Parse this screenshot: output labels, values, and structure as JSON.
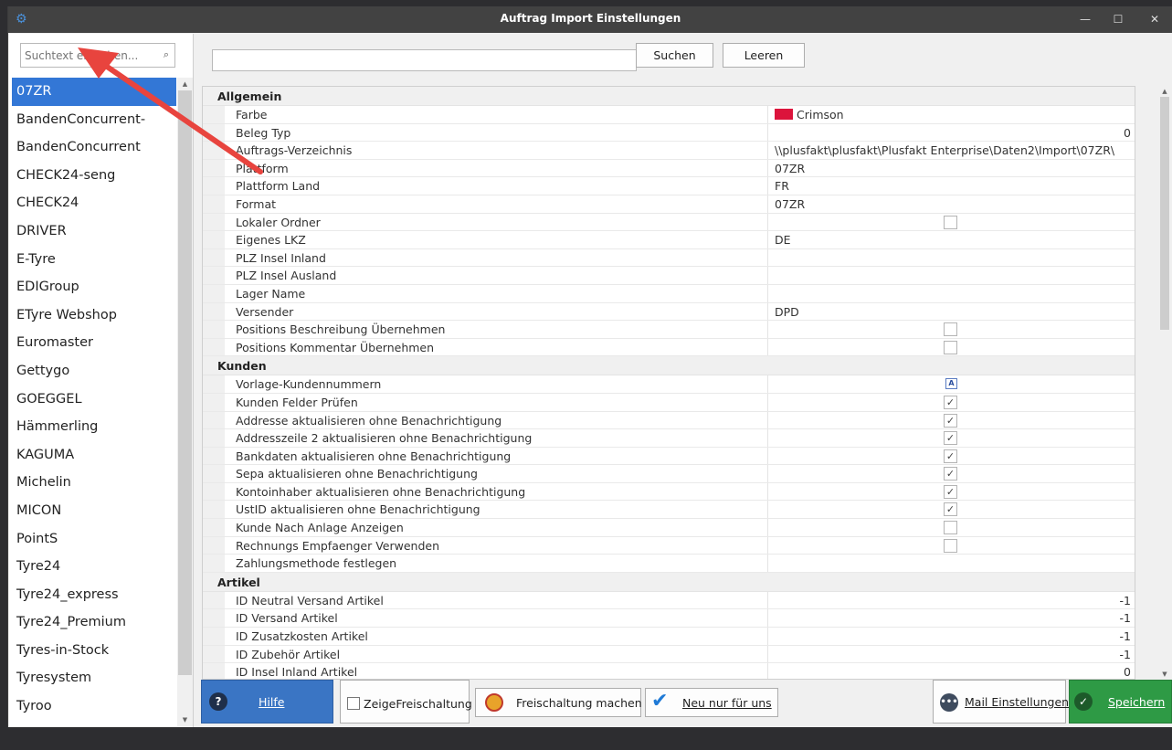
{
  "window": {
    "title": "Auftrag Import Einstellungen"
  },
  "sidebar": {
    "search_placeholder": "Suchtext eingeben...",
    "items": [
      "07ZR",
      "BandenConcurrent-",
      "BandenConcurrent",
      "CHECK24-seng",
      "CHECK24",
      "DRIVER",
      "E-Tyre",
      "EDIGroup",
      "ETyre Webshop",
      "Euromaster",
      "Gettygo",
      "GOEGGEL",
      "Hämmerling",
      "KAGUMA",
      "Michelin",
      "MICON",
      "PointS",
      "Tyre24",
      "Tyre24_express",
      "Tyre24_Premium",
      "Tyres-in-Stock",
      "Tyresystem",
      "Tyroo"
    ],
    "selected": "07ZR"
  },
  "toolbar": {
    "search_label": "Suchen",
    "clear_label": "Leeren"
  },
  "properties": {
    "allgemein": {
      "title": "Allgemein",
      "rows": {
        "farbe": {
          "label": "Farbe",
          "value": "Crimson",
          "color": "#dc143c"
        },
        "beleg_typ": {
          "label": "Beleg Typ",
          "value": "0"
        },
        "auftrags_verzeichnis": {
          "label": "Auftrags-Verzeichnis",
          "value": "\\\\plusfakt\\plusfakt\\Plusfakt Enterprise\\Daten2\\Import\\07ZR\\"
        },
        "plattform": {
          "label": "Plattform",
          "value": "07ZR"
        },
        "plattform_land": {
          "label": "Plattform Land",
          "value": "FR"
        },
        "format": {
          "label": "Format",
          "value": "07ZR"
        },
        "lokaler_ordner": {
          "label": "Lokaler Ordner",
          "checked": false
        },
        "eigenes_lkz": {
          "label": "Eigenes LKZ",
          "value": "DE"
        },
        "plz_insel_inland": {
          "label": "PLZ Insel Inland",
          "value": ""
        },
        "plz_insel_ausland": {
          "label": "PLZ Insel Ausland",
          "value": ""
        },
        "lager_name": {
          "label": "Lager Name",
          "value": ""
        },
        "versender": {
          "label": "Versender",
          "value": "DPD"
        },
        "positions_beschreibung": {
          "label": "Positions Beschreibung Übernehmen",
          "checked": false
        },
        "positions_kommentar": {
          "label": "Positions Kommentar Übernehmen",
          "checked": false
        }
      }
    },
    "kunden": {
      "title": "Kunden",
      "rows": {
        "vorlage": {
          "label": "Vorlage-Kundennummern",
          "value": "A"
        },
        "felder_pruefen": {
          "label": "Kunden Felder Prüfen",
          "checked": true
        },
        "addresse": {
          "label": "Addresse aktualisieren ohne Benachrichtigung",
          "checked": true
        },
        "addresszeile2": {
          "label": "Addresszeile 2 aktualisieren ohne Benachrichtigung",
          "checked": true
        },
        "bankdaten": {
          "label": "Bankdaten aktualisieren ohne Benachrichtigung",
          "checked": true
        },
        "sepa": {
          "label": "Sepa aktualisieren ohne Benachrichtigung",
          "checked": true
        },
        "kontoinhaber": {
          "label": "Kontoinhaber aktualisieren ohne Benachrichtigung",
          "checked": true
        },
        "ustid": {
          "label": "UstID aktualisieren ohne Benachrichtigung",
          "checked": true
        },
        "nach_anlage": {
          "label": "Kunde Nach Anlage Anzeigen",
          "checked": false
        },
        "rechnungs_empfaenger": {
          "label": "Rechnungs Empfaenger Verwenden",
          "checked": false
        },
        "zahlungsmethode": {
          "label": "Zahlungsmethode festlegen",
          "value": ""
        }
      }
    },
    "artikel": {
      "title": "Artikel",
      "rows": {
        "neutral_versand": {
          "label": "ID Neutral Versand Artikel",
          "value": "-1"
        },
        "versand": {
          "label": "ID Versand Artikel",
          "value": "-1"
        },
        "zusatzkosten": {
          "label": "ID Zusatzkosten Artikel",
          "value": "-1"
        },
        "zubehoer": {
          "label": "ID Zubehör Artikel",
          "value": "-1"
        },
        "insel_inland": {
          "label": "ID Insel Inland Artikel",
          "value": "0"
        }
      }
    }
  },
  "footer": {
    "help_label": "Hilfe",
    "show_unlock_label": "ZeigeFreischaltung",
    "unlock_label": "Freischaltung machen",
    "new_for_us_label": "Neu nur für uns",
    "mail_settings_label": "Mail Einstellungen",
    "save_label": "Speichern"
  },
  "colors": {
    "accent": "#3377d6",
    "help": "#3a75c4",
    "save": "#2e9a45",
    "titlebar": "#424242"
  },
  "icons": [
    "gear-icon",
    "search-icon",
    "help-icon",
    "certificate-icon",
    "checkmark-icon",
    "ellipsis-icon",
    "save-check-icon"
  ]
}
